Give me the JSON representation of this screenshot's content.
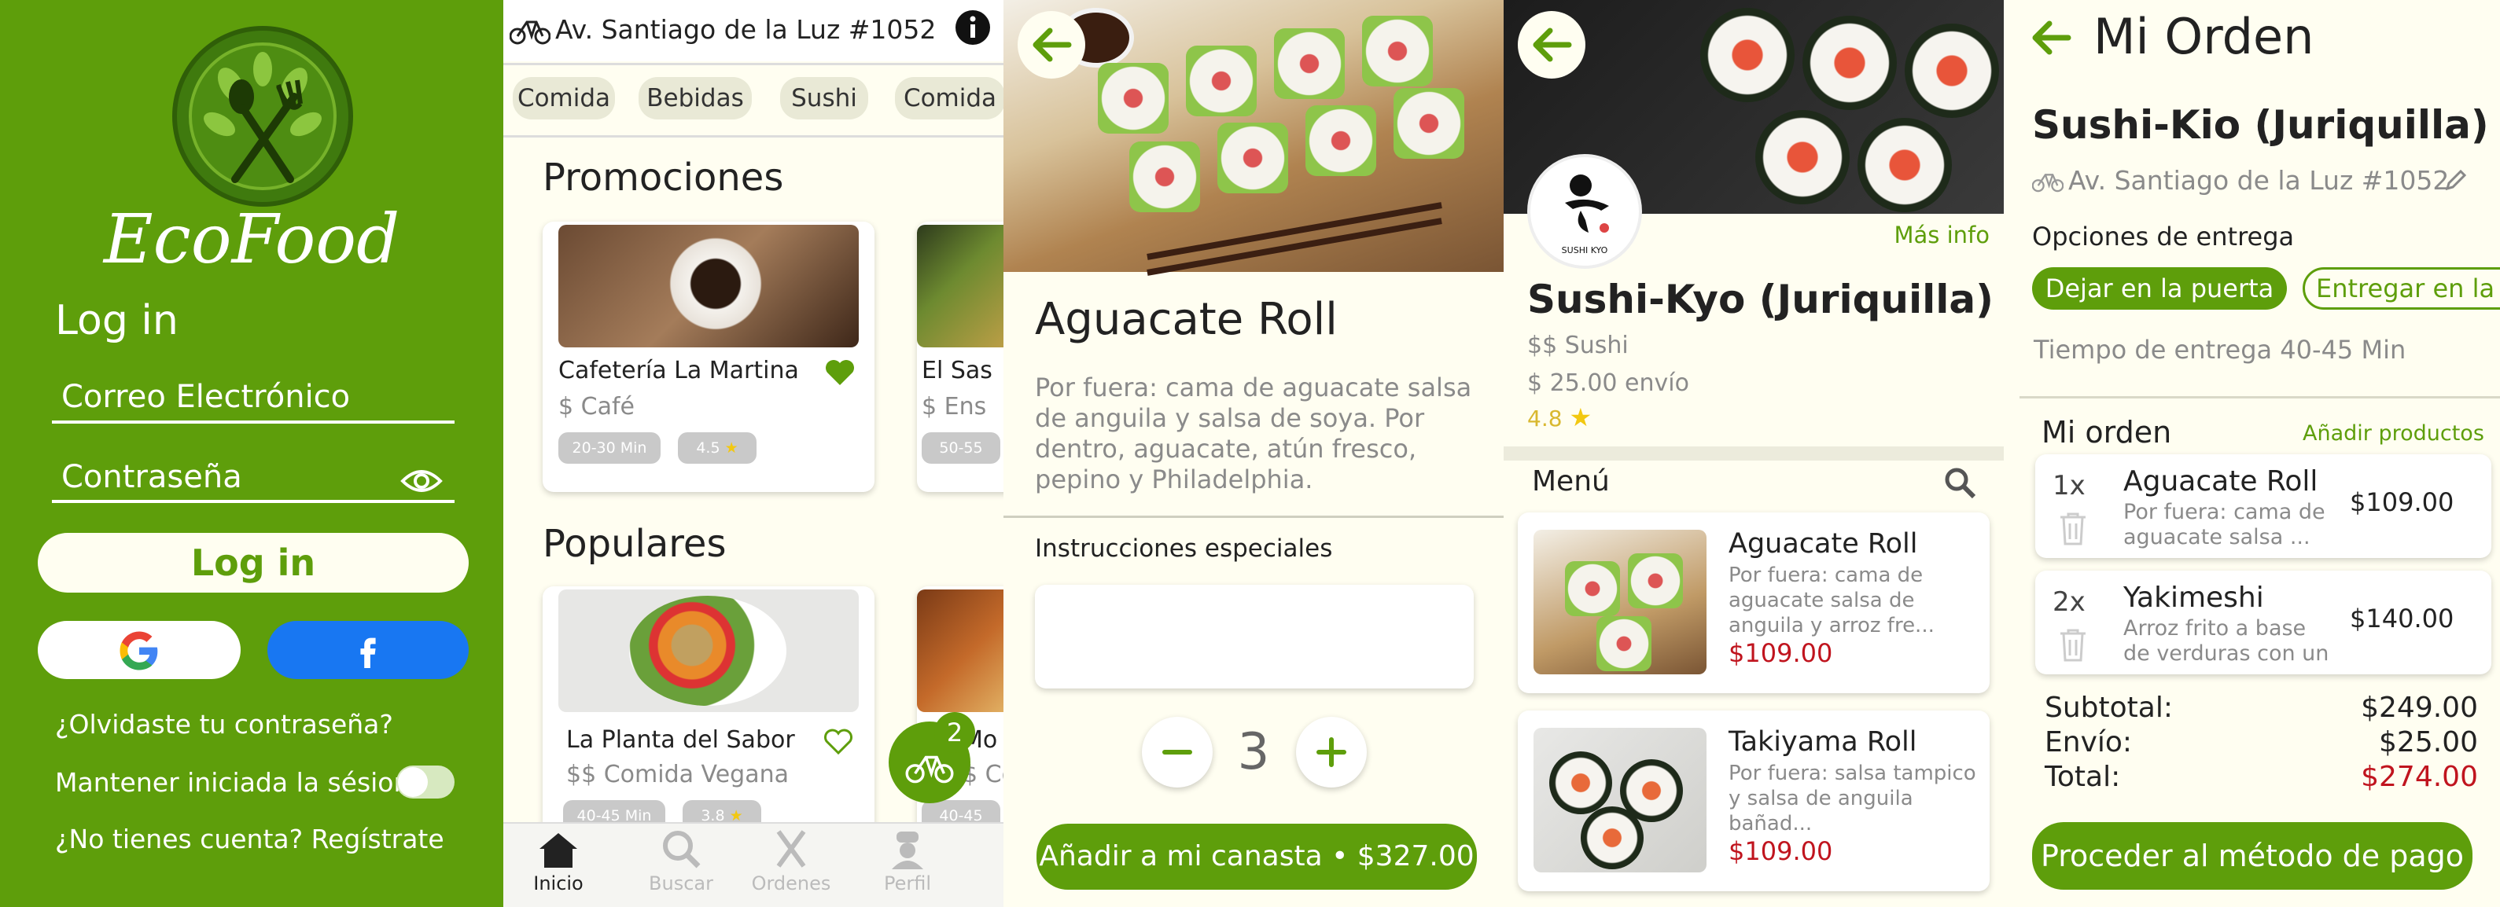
{
  "login": {
    "brand": "EcoFood",
    "title": "Log in",
    "email_placeholder": "Correo Electrónico",
    "password_placeholder": "Contraseña",
    "login_button": "Log in",
    "forgot": "¿Olvidaste tu contraseña?",
    "keep_session": "Mantener iniciada la sésion",
    "register": "¿No tienes cuenta? Regístrate"
  },
  "home": {
    "address": "Av. Santiago de la Luz #1052",
    "categories": [
      "Comida",
      "Bebidas",
      "Sushi",
      "Comida"
    ],
    "promos_title": "Promociones",
    "populares_title": "Populares",
    "promos": [
      {
        "name": "Cafetería La Martina",
        "type": "$ Café",
        "time": "20-30 Min",
        "rating": "4.5"
      },
      {
        "name": "El Sas",
        "type": "$ Ens",
        "time": "50-55"
      }
    ],
    "populares": [
      {
        "name": "La Planta del Sabor",
        "type": "$$ Comida Vegana",
        "time": "40-45 Min",
        "rating": "3.8"
      },
      {
        "name": "Mo",
        "type": "$ Co",
        "time": "40-45"
      }
    ],
    "cart_count": "2",
    "nav": [
      "Inicio",
      "Buscar",
      "Ordenes",
      "Perfil"
    ]
  },
  "product": {
    "name": "Aguacate Roll",
    "description": "Por fuera: cama de aguacate salsa de anguila y salsa de soya. Por dentro, aguacate, atún fresco, pepino y Philadelphia.",
    "instructions_label": "Instrucciones especiales",
    "quantity": "3",
    "add_button": "Añadir a mi canasta • $327.00"
  },
  "restaurant": {
    "name": "Sushi-Kyo (Juriquilla)",
    "mas_info": "Más info",
    "category": "$$ Sushi",
    "shipping": "$ 25.00 envío",
    "rating": "4.8",
    "menu_label": "Menú",
    "logo_text": "SUSHI KYO",
    "items": [
      {
        "name": "Aguacate Roll",
        "desc": "Por fuera: cama de aguacate salsa de anguila y arroz fre...",
        "price": "$109.00"
      },
      {
        "name": "Takiyama Roll",
        "desc": "Por fuera: salsa tampico y salsa de anguila  bañad...",
        "price": "$109.00"
      }
    ]
  },
  "order": {
    "title": "Mi Orden",
    "restaurant": "Sushi-Kio (Juriquilla)",
    "address": "Av. Santiago de la Luz #1052",
    "delivery_label": "Opciones de entrega",
    "option1": "Dejar en la puerta",
    "option2": "Entregar en la m",
    "delivery_time": "Tiempo de entrega 40-45 Min",
    "mi_orden": "Mi orden",
    "add_products": "Añadir productos",
    "items": [
      {
        "qty": "1x",
        "name": "Aguacate Roll",
        "desc": "Por fuera: cama de aguacate salsa ...",
        "price": "$109.00"
      },
      {
        "qty": "2x",
        "name": "Yakimeshi",
        "desc": "Arroz frito a base de verduras con un ...",
        "price": "$140.00"
      }
    ],
    "subtotal_label": "Subtotal:",
    "subtotal": "$249.00",
    "envio_label": "Envío:",
    "envio": "$25.00",
    "total_label": "Total:",
    "total": "$274.00",
    "pay_button": "Proceder al método de pago"
  },
  "colors": {
    "brand_green": "#5e9e0b",
    "cream": "#fffef1",
    "facebook_blue": "#1877f2",
    "price_red": "#c0141e",
    "star_yellow": "#f2c811"
  }
}
